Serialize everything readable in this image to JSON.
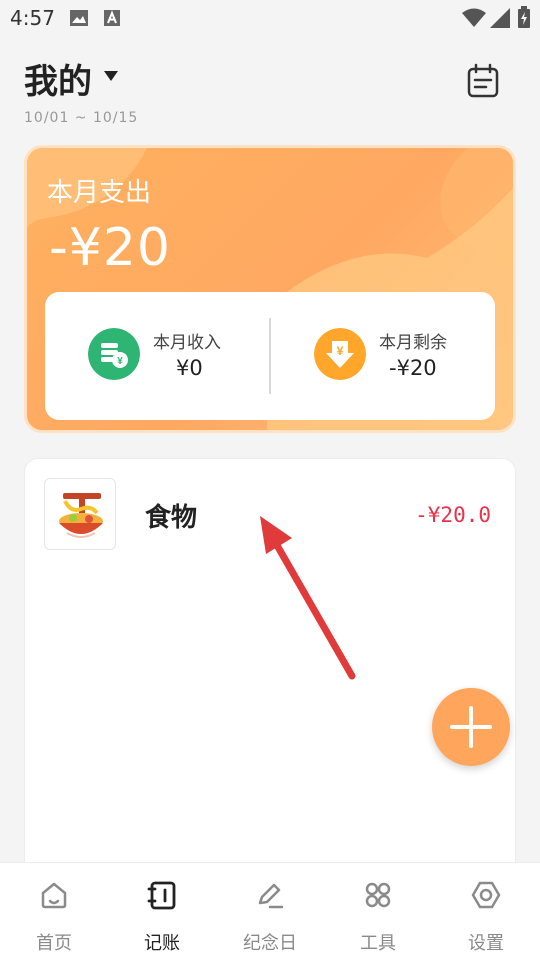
{
  "status_bar": {
    "time": "4:57",
    "icons": [
      "image-icon",
      "a-icon",
      "wifi-icon",
      "signal-icon",
      "battery-icon"
    ]
  },
  "header": {
    "title": "我的",
    "date_range": "10/01 ~ 10/15"
  },
  "summary": {
    "expense_label": "本月支出",
    "expense_amount": "-¥20",
    "income_label": "本月收入",
    "income_amount": "¥0",
    "remaining_label": "本月剩余",
    "remaining_amount": "-¥20"
  },
  "records": [
    {
      "category": "食物",
      "amount": "-¥20.0",
      "icon": "noodle-bowl-icon"
    }
  ],
  "nav": {
    "items": [
      {
        "label": "首页",
        "icon": "home-icon",
        "active": false
      },
      {
        "label": "记账",
        "icon": "ledger-icon",
        "active": true
      },
      {
        "label": "纪念日",
        "icon": "pen-icon",
        "active": false
      },
      {
        "label": "工具",
        "icon": "grid-icon",
        "active": false
      },
      {
        "label": "设置",
        "icon": "settings-icon",
        "active": false
      }
    ]
  },
  "colors": {
    "accent": "#ffa65c",
    "expense_red": "#e8334a",
    "income_green": "#2fb573",
    "remaining_orange": "#ffa62b"
  }
}
